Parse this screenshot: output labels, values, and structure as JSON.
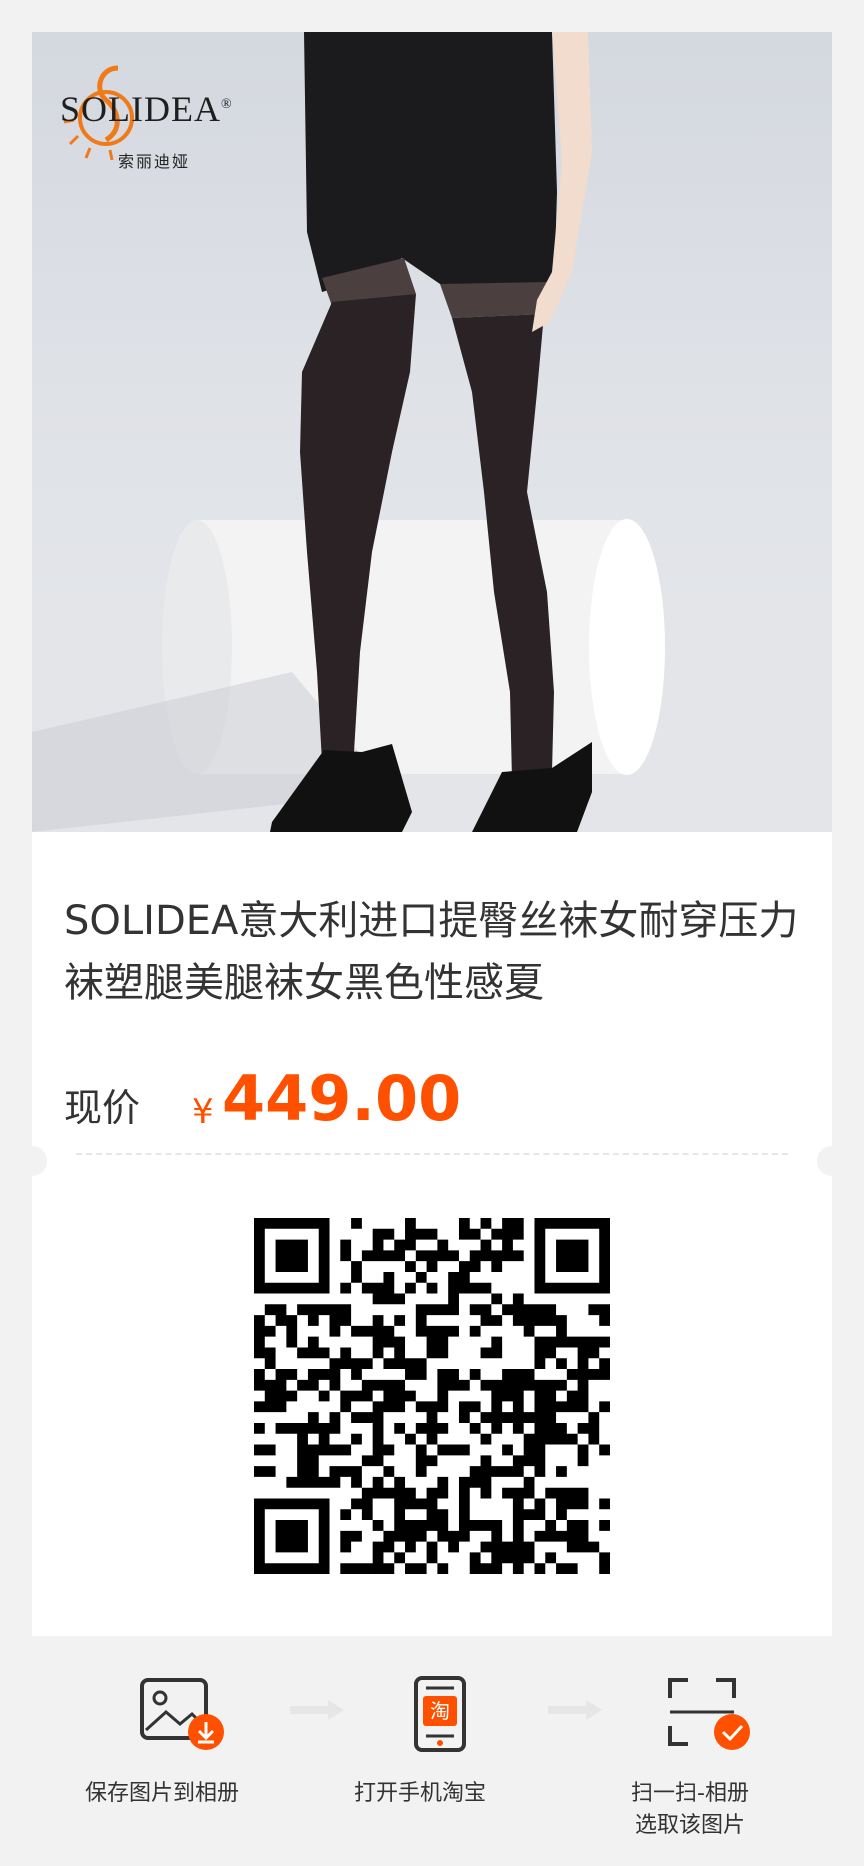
{
  "brand": {
    "name": "SOLIDEA",
    "registered_mark": "®",
    "chinese_name": "索丽迪娅"
  },
  "product": {
    "title": "SOLIDEA意大利进口提臀丝袜女耐穿压力袜塑腿美腿袜女黑色性感夏",
    "price_label": "现价",
    "currency_symbol": "¥",
    "price": "449.00"
  },
  "steps": [
    {
      "label": "保存图片到相册",
      "icon": "image-download-icon"
    },
    {
      "label": "打开手机淘宝",
      "icon": "taobao-phone-icon",
      "badge": "淘"
    },
    {
      "label": "扫一扫-相册\n选取该图片",
      "line1": "扫一扫-相册",
      "line2": "选取该图片",
      "icon": "scan-check-icon"
    }
  ],
  "colors": {
    "accent": "#ff5000",
    "background": "#f2f2f2",
    "card": "#ffffff",
    "text": "#333333"
  }
}
